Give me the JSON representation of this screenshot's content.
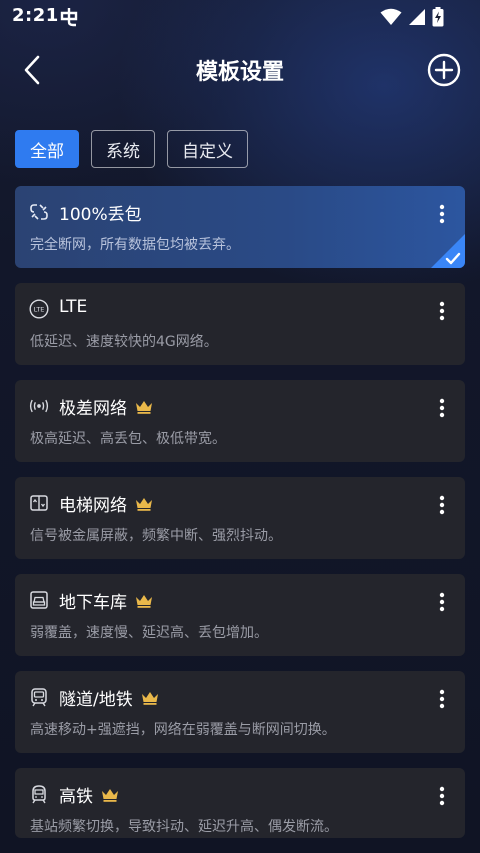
{
  "status_bar": {
    "time": "2:21"
  },
  "header": {
    "title": "模板设置"
  },
  "filters": [
    {
      "label": "全部",
      "active": true
    },
    {
      "label": "系统",
      "active": false
    },
    {
      "label": "自定义",
      "active": false
    }
  ],
  "templates": [
    {
      "title": "100%丢包",
      "desc": "完全断网，所有数据包均被丢弃。",
      "icon": "link-broken-icon",
      "premium": false,
      "selected": true
    },
    {
      "title": "LTE",
      "desc": "低延迟、速度较快的4G网络。",
      "icon": "lte-icon",
      "premium": false,
      "selected": false
    },
    {
      "title": "极差网络",
      "desc": "极高延迟、高丢包、极低带宽。",
      "icon": "signal-broadcast-icon",
      "premium": true,
      "selected": false
    },
    {
      "title": "电梯网络",
      "desc": "信号被金属屏蔽，频繁中断、强烈抖动。",
      "icon": "elevator-icon",
      "premium": true,
      "selected": false
    },
    {
      "title": "地下车库",
      "desc": "弱覆盖，速度慢、延迟高、丢包增加。",
      "icon": "garage-icon",
      "premium": true,
      "selected": false
    },
    {
      "title": "隧道/地铁",
      "desc": "高速移动+强遮挡，网络在弱覆盖与断网间切换。",
      "icon": "subway-icon",
      "premium": true,
      "selected": false
    },
    {
      "title": "高铁",
      "desc": "基站频繁切换，导致抖动、延迟升高、偶发断流。",
      "icon": "high-speed-train-icon",
      "premium": true,
      "selected": false
    }
  ],
  "colors": {
    "accent": "#2f7bf0",
    "crown": "#e9b84a",
    "card_bg": "#24252c"
  }
}
